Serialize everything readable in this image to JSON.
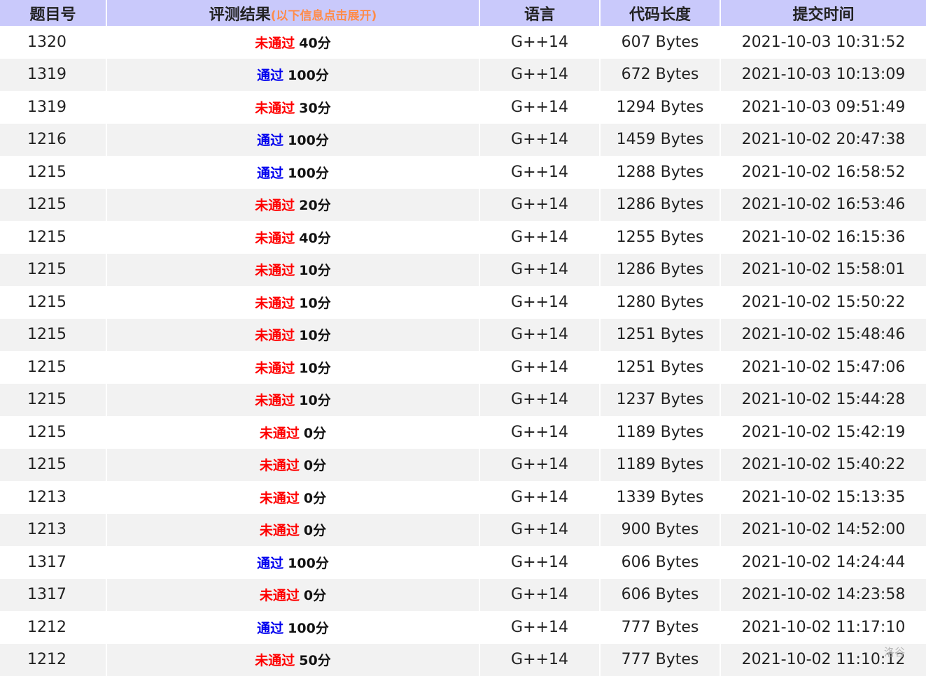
{
  "header": {
    "problem": "题目号",
    "result": "评测结果",
    "result_hint": "(以下信息点击展开)",
    "language": "语言",
    "code_length": "代码长度",
    "submit_time": "提交时间"
  },
  "status_colors": {
    "fail": "#ff0000",
    "pass": "#0000ee"
  },
  "rows": [
    {
      "problem": "1320",
      "status": "未通过",
      "status_type": "fail",
      "score": "40分",
      "language": "G++14",
      "length": "607 Bytes",
      "time": "2021-10-03 10:31:52"
    },
    {
      "problem": "1319",
      "status": "通过",
      "status_type": "pass",
      "score": "100分",
      "language": "G++14",
      "length": "672 Bytes",
      "time": "2021-10-03 10:13:09"
    },
    {
      "problem": "1319",
      "status": "未通过",
      "status_type": "fail",
      "score": "30分",
      "language": "G++14",
      "length": "1294 Bytes",
      "time": "2021-10-03 09:51:49"
    },
    {
      "problem": "1216",
      "status": "通过",
      "status_type": "pass",
      "score": "100分",
      "language": "G++14",
      "length": "1459 Bytes",
      "time": "2021-10-02 20:47:38"
    },
    {
      "problem": "1215",
      "status": "通过",
      "status_type": "pass",
      "score": "100分",
      "language": "G++14",
      "length": "1288 Bytes",
      "time": "2021-10-02 16:58:52"
    },
    {
      "problem": "1215",
      "status": "未通过",
      "status_type": "fail",
      "score": "20分",
      "language": "G++14",
      "length": "1286 Bytes",
      "time": "2021-10-02 16:53:46"
    },
    {
      "problem": "1215",
      "status": "未通过",
      "status_type": "fail",
      "score": "40分",
      "language": "G++14",
      "length": "1255 Bytes",
      "time": "2021-10-02 16:15:36"
    },
    {
      "problem": "1215",
      "status": "未通过",
      "status_type": "fail",
      "score": "10分",
      "language": "G++14",
      "length": "1286 Bytes",
      "time": "2021-10-02 15:58:01"
    },
    {
      "problem": "1215",
      "status": "未通过",
      "status_type": "fail",
      "score": "10分",
      "language": "G++14",
      "length": "1280 Bytes",
      "time": "2021-10-02 15:50:22"
    },
    {
      "problem": "1215",
      "status": "未通过",
      "status_type": "fail",
      "score": "10分",
      "language": "G++14",
      "length": "1251 Bytes",
      "time": "2021-10-02 15:48:46"
    },
    {
      "problem": "1215",
      "status": "未通过",
      "status_type": "fail",
      "score": "10分",
      "language": "G++14",
      "length": "1251 Bytes",
      "time": "2021-10-02 15:47:06"
    },
    {
      "problem": "1215",
      "status": "未通过",
      "status_type": "fail",
      "score": "10分",
      "language": "G++14",
      "length": "1237 Bytes",
      "time": "2021-10-02 15:44:28"
    },
    {
      "problem": "1215",
      "status": "未通过",
      "status_type": "fail",
      "score": "0分",
      "language": "G++14",
      "length": "1189 Bytes",
      "time": "2021-10-02 15:42:19"
    },
    {
      "problem": "1215",
      "status": "未通过",
      "status_type": "fail",
      "score": "0分",
      "language": "G++14",
      "length": "1189 Bytes",
      "time": "2021-10-02 15:40:22"
    },
    {
      "problem": "1213",
      "status": "未通过",
      "status_type": "fail",
      "score": "0分",
      "language": "G++14",
      "length": "1339 Bytes",
      "time": "2021-10-02 15:13:35"
    },
    {
      "problem": "1213",
      "status": "未通过",
      "status_type": "fail",
      "score": "0分",
      "language": "G++14",
      "length": "900 Bytes",
      "time": "2021-10-02 14:52:00"
    },
    {
      "problem": "1317",
      "status": "通过",
      "status_type": "pass",
      "score": "100分",
      "language": "G++14",
      "length": "606 Bytes",
      "time": "2021-10-02 14:24:44"
    },
    {
      "problem": "1317",
      "status": "未通过",
      "status_type": "fail",
      "score": "0分",
      "language": "G++14",
      "length": "606 Bytes",
      "time": "2021-10-02 14:23:58"
    },
    {
      "problem": "1212",
      "status": "通过",
      "status_type": "pass",
      "score": "100分",
      "language": "G++14",
      "length": "777 Bytes",
      "time": "2021-10-02 11:17:10"
    },
    {
      "problem": "1212",
      "status": "未通过",
      "status_type": "fail",
      "score": "50分",
      "language": "G++14",
      "length": "777 Bytes",
      "time": "2021-10-02 11:10:12"
    }
  ],
  "watermark": "洛谷"
}
